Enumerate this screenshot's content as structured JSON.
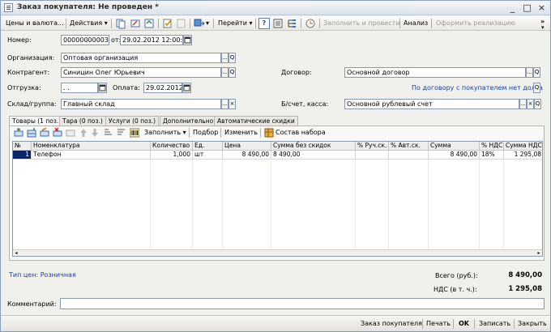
{
  "window": {
    "title": "Заказ покупателя: Не проведен *",
    "minimize_glyph": "_",
    "maximize_glyph": "□",
    "close_glyph": "×"
  },
  "toolbar": {
    "prices_label": "Цены и валюта...",
    "actions_label": "Действия",
    "goto_label": "Перейти",
    "help_label": "?",
    "fill_and_post_label": "Заполнить и провести",
    "analysis_label": "Анализ",
    "register_sale_label": "Оформить реализацию",
    "more_glyph": "»"
  },
  "form": {
    "number_label": "Номер:",
    "number_value": "00000000003",
    "from_label": "от:",
    "date_value": "29.02.2012 12:00:00",
    "organization_label": "Организация:",
    "organization_value": "Оптовая организация",
    "counterparty_label": "Контрагент:",
    "counterparty_value": "Синицин Олег Юрьевич",
    "contract_label": "Договор:",
    "contract_value": "Основной договор",
    "shipment_label": "Отгрузка:",
    "shipment_value": " .  .",
    "payment_label": "Оплата:",
    "payment_value": "29.02.2012",
    "contract_debt_link": "По договору с покупателем нет долга",
    "warehouse_label": "Склад/группа:",
    "warehouse_value": "Главный склад",
    "account_label": "Б/счет, касса:",
    "account_value": "Основной рублевый счет",
    "choose_glyph": "...",
    "search_glyph": "Q",
    "clear_glyph": "×"
  },
  "tabs": [
    {
      "label": "Товары (1 поз.)",
      "active": true
    },
    {
      "label": "Тара (0 поз.)",
      "active": false
    },
    {
      "label": "Услуги (0 поз.)",
      "active": false
    },
    {
      "label": "Дополнительно",
      "active": false
    },
    {
      "label": "Автоматические скидки",
      "active": false
    }
  ],
  "grid_toolbar": {
    "fill_label": "Заполнить",
    "selection_label": "Подбор",
    "change_label": "Изменить",
    "kit_label": "Состав набора"
  },
  "table": {
    "columns": [
      "№",
      "Номенклатура",
      "Количество",
      "Ед.",
      "Цена",
      "Сумма без скидок",
      "% Руч.ск.",
      "% Авт.ск.",
      "Сумма",
      "% НДС",
      "Сумма НДС"
    ],
    "rows": [
      [
        "1",
        "Телефон",
        "1,000",
        "шт",
        "8 490,00",
        "8 490,00",
        "",
        "",
        "8 490,00",
        "18%",
        "1 295,08"
      ]
    ]
  },
  "footer": {
    "price_type_link": "Тип цен: Розничная",
    "total_label": "Всего (руб.):",
    "total_value": "8 490,00",
    "vat_label": "НДС (в т. ч.):",
    "vat_value": "1 295,08",
    "comment_label": "Комментарий:",
    "comment_value": ""
  },
  "bottom_bar": {
    "order_label": "Заказ покупателя",
    "print_label": "Печать",
    "ok_label": "OK",
    "save_label": "Записать",
    "close_label": "Закрыть"
  },
  "colors": {
    "selection": "#0a246a",
    "link": "#1a3fa0"
  }
}
